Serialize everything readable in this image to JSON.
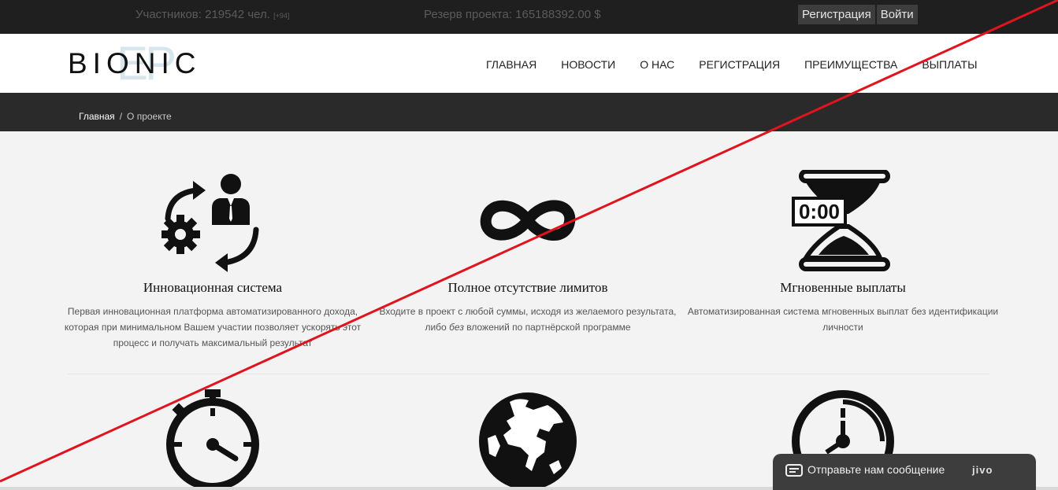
{
  "topbar": {
    "members_label": "Участников: 219542 чел.",
    "members_delta": "[+94]",
    "reserve_label": "Резерв проекта: 165188392.00 $",
    "register_button": "Регистрация",
    "login_button": "Войти"
  },
  "header": {
    "logo_mark": "EP",
    "logo_word": "BIONIC",
    "nav": [
      "ГЛАВНАЯ",
      "НОВОСТИ",
      "О НАС",
      "РЕГИСТРАЦИЯ",
      "ПРЕИМУЩЕСТВА",
      "ВЫПЛАТЫ"
    ]
  },
  "breadcrumb": {
    "home": "Главная",
    "separator": "/",
    "current": "О проекте"
  },
  "features": [
    {
      "icon": "innovation-cycle-icon",
      "title": "Инновационная система",
      "text": "Первая инновационная платформа автоматизированного дохода, которая при минимальном Вашем участии позволяет ускорять этот процесс и получать максимальный результат"
    },
    {
      "icon": "infinity-icon",
      "title": "Полное отсутствие лимитов",
      "text_before": "Входите в проект с любой суммы, исходя из желаемого результата, либо ",
      "text_em": "без",
      "text_after": " вложений по партнёрской программе"
    },
    {
      "icon": "hourglass-timer-icon",
      "title": "Мгновенные выплаты",
      "text": "Автоматизированная система мгновенных выплат без идентификации личности",
      "timer_text": "0:00"
    }
  ],
  "second_row_icons": [
    "stopwatch-icon",
    "globe-icon",
    "clock-speed-icon"
  ],
  "chat": {
    "text": "Отправьте нам сообщение",
    "brand": "jivo"
  },
  "colors": {
    "topbar_bg": "#1f1f1f",
    "crumb_bg": "#2a2a2a",
    "page_bg": "#f3f3f3",
    "strike": "#e0141e",
    "chat_bg": "#3d3d3d"
  }
}
